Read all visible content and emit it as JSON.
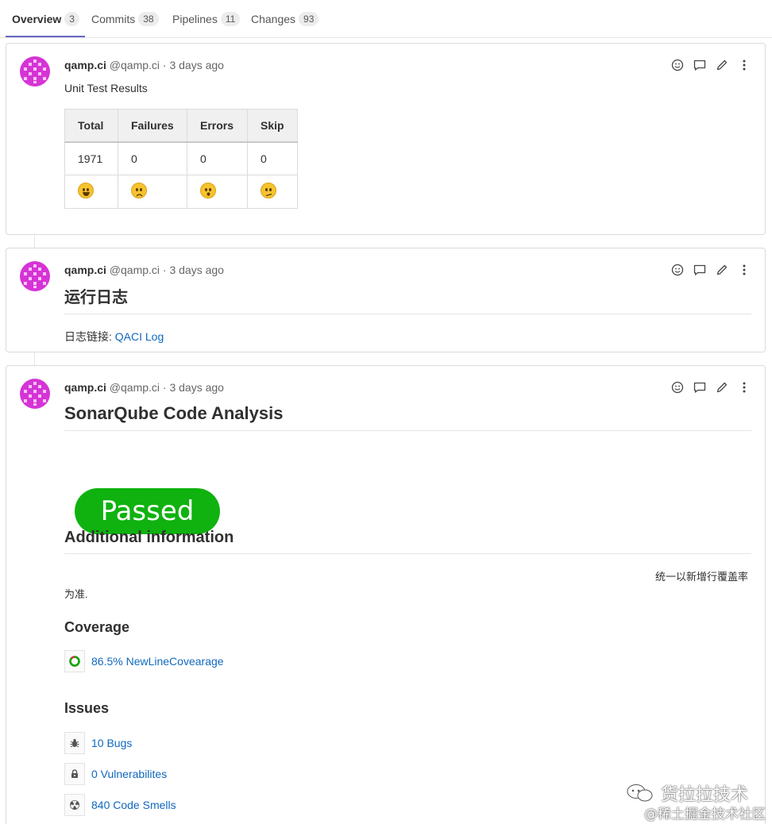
{
  "tabs": [
    {
      "label": "Overview",
      "count": "3"
    },
    {
      "label": "Commits",
      "count": "38"
    },
    {
      "label": "Pipelines",
      "count": "11"
    },
    {
      "label": "Changes",
      "count": "93"
    }
  ],
  "note_actions": [
    "smiley-icon",
    "comment-icon",
    "pencil-icon",
    "more-vertical-icon"
  ],
  "notes": [
    {
      "author": "qamp.ci",
      "username": "@qamp.ci",
      "time": "· 3 days ago",
      "title": "Unit Test Results",
      "table": {
        "headers": [
          "Total",
          "Failures",
          "Errors",
          "Skip"
        ],
        "values": [
          "1971",
          "0",
          "0",
          "0"
        ],
        "emojis": [
          "grinning-face-icon",
          "slightly-frowning-face-icon",
          "open-mouth-face-icon",
          "confused-face-icon"
        ]
      }
    },
    {
      "author": "qamp.ci",
      "username": "@qamp.ci",
      "time": "· 3 days ago",
      "heading": "运行日志",
      "log_label": "日志链接: ",
      "log_link": "QACI Log"
    },
    {
      "author": "qamp.ci",
      "username": "@qamp.ci",
      "time": "· 3 days ago",
      "heading": "SonarQube Code Analysis",
      "status": "Passed",
      "status_color": "#0fb20f",
      "additional_heading": "Additional information",
      "note_line1": "统一以新增行覆盖率",
      "note_line2": "为准.",
      "coverage_heading": "Coverage",
      "coverage_link": "86.5% NewLineCovearage",
      "coverage_value": 86.5,
      "issues_heading": "Issues",
      "issues": [
        {
          "icon": "bug-icon",
          "label": "10 Bugs"
        },
        {
          "icon": "lock-icon",
          "label": "0 Vulnerabilites"
        },
        {
          "icon": "radiation-icon",
          "label": "840 Code Smells"
        }
      ]
    }
  ],
  "watermark": {
    "line1": "货拉拉技术",
    "line2": "@稀土掘金技术社区"
  },
  "colors": {
    "accent": "#6666c4",
    "link": "#1068bf",
    "avatar": "#d633d6"
  }
}
